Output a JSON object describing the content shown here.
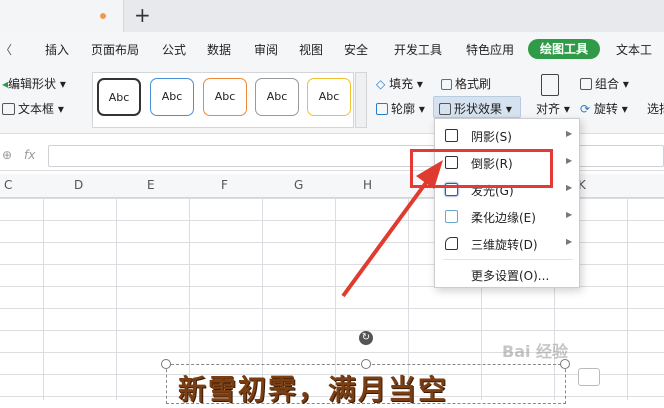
{
  "menubar": {
    "items": [
      "插入",
      "页面布局",
      "公式",
      "数据",
      "审阅",
      "视图",
      "安全",
      "开发工具",
      "特色应用"
    ],
    "active": "绘图工具",
    "last": "文本工"
  },
  "ribbon": {
    "edit_shape": "编辑形状",
    "text_box": "文本框",
    "style_sample": "Abc",
    "fill": "填充",
    "format_painter": "格式刷",
    "outline": "轮廓",
    "shape_effects": "形状效果",
    "group": "组合",
    "align": "对齐",
    "rotate": "旋转",
    "select": "选择"
  },
  "formula": {
    "fx": "fx"
  },
  "columns": [
    "C",
    "D",
    "E",
    "F",
    "G",
    "H",
    "K"
  ],
  "dropdown": {
    "items": [
      {
        "label": "阴影(S)",
        "icon": "shadow-icon"
      },
      {
        "label": "倒影(R)",
        "icon": "reflection-icon"
      },
      {
        "label": "发光(G)",
        "icon": "glow-icon"
      },
      {
        "label": "柔化边缘(E)",
        "icon": "soft-edge-icon"
      },
      {
        "label": "三维旋转(D)",
        "icon": "3d-rotation-icon"
      }
    ],
    "more": "更多设置(O)..."
  },
  "wordart": {
    "text": "新雪初霁，满月当空"
  },
  "watermark": "Bai 经验",
  "colors": {
    "accent_green": "#2f9a48",
    "highlight_red": "#e53935",
    "arrow_red": "#e03b2f"
  }
}
